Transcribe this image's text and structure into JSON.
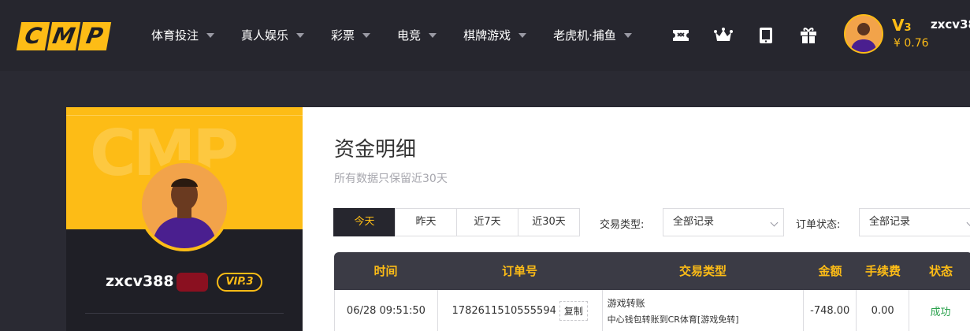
{
  "brand": {
    "letters": [
      "C",
      "M",
      "P"
    ],
    "color": "#fdbc16"
  },
  "nav": {
    "items": [
      {
        "label": "体育投注"
      },
      {
        "label": "真人娱乐"
      },
      {
        "label": "彩票"
      },
      {
        "label": "电竞"
      },
      {
        "label": "棋牌游戏"
      },
      {
        "label": "老虎机·捕鱼"
      }
    ]
  },
  "header_icons": [
    "ticket-icon",
    "crown-icon",
    "tablet-icon",
    "gift-icon"
  ],
  "user": {
    "vip_level": "V",
    "vip_num": "3",
    "balance": "¥ 0.76",
    "username_top": "zxcv38",
    "username_profile": "zxcv388",
    "vip_badge": "VIP.3"
  },
  "page": {
    "title": "资金明细",
    "subtitle": "所有数据只保留近30天"
  },
  "filters": {
    "ranges": [
      "今天",
      "昨天",
      "近7天",
      "近30天"
    ],
    "active_range": "今天",
    "type_label": "交易类型:",
    "type_value": "全部记录",
    "status_label": "订单状态:",
    "status_value": "全部记录"
  },
  "table": {
    "headers": [
      "时间",
      "订单号",
      "交易类型",
      "金额",
      "手续费",
      "状态"
    ],
    "rows": [
      {
        "time": "06/28 09:51:50",
        "order_no": "1782611510555594",
        "copy_label": "复制",
        "type_main": "游戏转账",
        "type_sub": "中心钱包转账到CR体育[游戏免转]",
        "amount": "-748.00",
        "fee": "0.00",
        "status": "成功"
      }
    ]
  }
}
